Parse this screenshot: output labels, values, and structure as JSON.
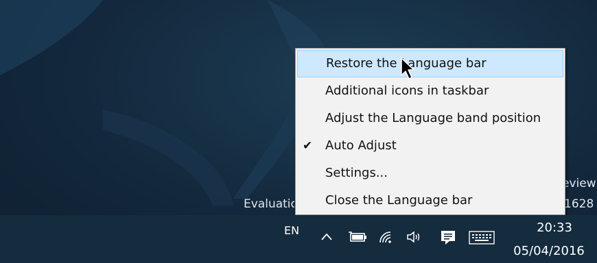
{
  "watermark": {
    "edition_fragment": "Evaluation",
    "preview_fragment": "eview",
    "build_fragment": "1628"
  },
  "context_menu": {
    "items": [
      {
        "label": "Restore the Language bar",
        "highlighted": true,
        "checked": false
      },
      {
        "label": "Additional icons in taskbar",
        "highlighted": false,
        "checked": false
      },
      {
        "label": "Adjust the Language band position",
        "highlighted": false,
        "checked": false
      },
      {
        "label": "Auto Adjust",
        "highlighted": false,
        "checked": true
      },
      {
        "label": "Settings...",
        "highlighted": false,
        "checked": false
      },
      {
        "label": "Close the Language bar",
        "highlighted": false,
        "checked": false
      }
    ],
    "check_glyph": "✔"
  },
  "taskbar": {
    "language": "EN",
    "tray_icons": [
      "chevron-up-icon",
      "battery-icon",
      "wifi-icon",
      "volume-icon",
      "notification-icon",
      "keyboard-icon"
    ],
    "clock_time": "20:33",
    "clock_date": "05/04/2016"
  },
  "colors": {
    "desktop": "#13283c",
    "taskbar": "#152b3e",
    "menu_bg": "#f2f2f2",
    "menu_highlight": "#cde8ff",
    "menu_highlight_border": "#99d1ff"
  }
}
